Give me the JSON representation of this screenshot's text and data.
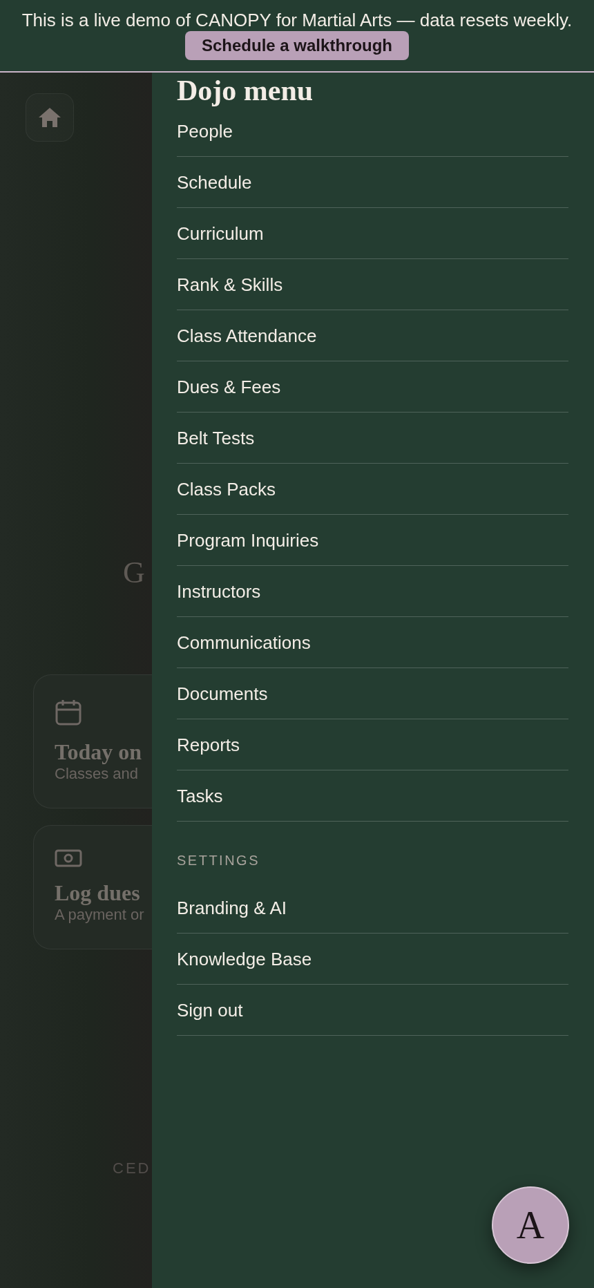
{
  "banner": {
    "message": "This is a live demo of CANOPY for Martial Arts — data resets weekly.",
    "button": "Schedule a walkthrough"
  },
  "background": {
    "heading": "G",
    "cards": [
      {
        "kind": "calendar",
        "title": "Today on",
        "subtitle": "Classes and"
      },
      {
        "kind": "cash",
        "title": "Log dues",
        "subtitle": "A payment or"
      }
    ],
    "footer": "CED"
  },
  "drawer": {
    "title": "Dojo menu",
    "items": [
      "People",
      "Schedule",
      "Curriculum",
      "Rank & Skills",
      "Class Attendance",
      "Dues & Fees",
      "Belt Tests",
      "Class Packs",
      "Program Inquiries",
      "Instructors",
      "Communications",
      "Documents",
      "Reports",
      "Tasks"
    ],
    "settings_label": "SETTINGS",
    "settings_items": [
      "Branding & AI",
      "Knowledge Base",
      "Sign out"
    ]
  },
  "fab": {
    "label": "A"
  }
}
